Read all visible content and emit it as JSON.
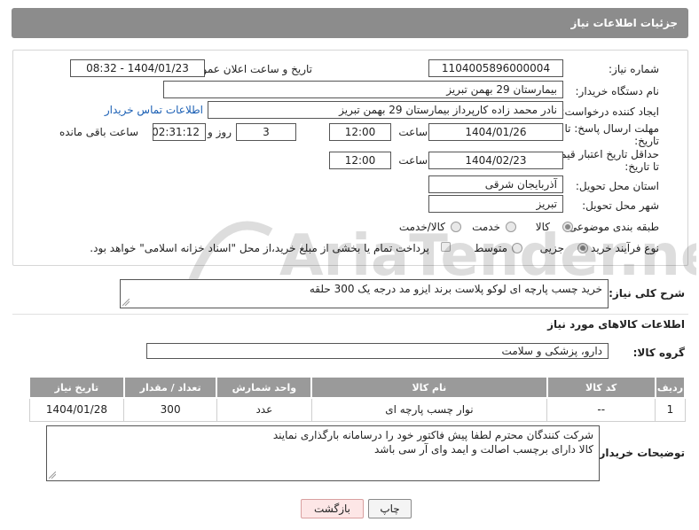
{
  "header": {
    "title": "جزئیات اطلاعات نیاز"
  },
  "fields": {
    "need_number_label": "شماره نیاز:",
    "need_number": "1104005896000004",
    "announce_label": "تاریخ و ساعت اعلان عمومی:",
    "announce_value": "1404/01/23 - 08:32",
    "buyer_org_label": "نام دستگاه خریدار:",
    "buyer_org": "بیمارستان 29 بهمن تبریز",
    "creator_label": "ایجاد کننده درخواست:",
    "creator": "نادر محمد زاده کارپرداز بیمارستان 29 بهمن تبریز",
    "buyer_contact_link": "اطلاعات تماس خریدار",
    "reply_deadline_label_1": "مهلت ارسال پاسخ: تا",
    "reply_deadline_label_2": "تاریخ:",
    "reply_date": "1404/01/26",
    "time_label": "ساعت",
    "reply_time": "12:00",
    "days_value": "3",
    "days_label": "روز و",
    "remaining_time": "02:31:12",
    "remaining_label": "ساعت باقی مانده",
    "price_validity_label_1": "حداقل تاریخ اعتبار قیمت:",
    "price_validity_label_2": "تا تاریخ:",
    "validity_date": "1404/02/23",
    "validity_time": "12:00",
    "province_label": "استان محل تحویل:",
    "province": "آذربایجان شرقی",
    "city_label": "شهر محل تحویل:",
    "city": "تبریز",
    "category_label": "طبقه بندی موضوعی:",
    "category_options": [
      "کالا",
      "خدمت",
      "کالا/خدمت"
    ],
    "process_label": "نوع فرآیند خرید :",
    "process_options": [
      "جزیی",
      "متوسط"
    ],
    "payment_note": "پرداخت تمام یا بخشی از مبلغ خرید،از محل \"اسناد خزانه اسلامی\" خواهد بود."
  },
  "description": {
    "label": "شرح کلی نیاز:",
    "text": "خرید چسب پارچه ای لوکو پلاست برند ایزو مد درجه یک 300 حلقه"
  },
  "goods": {
    "section_title": "اطلاعات کالاهای مورد نیاز",
    "group_label": "گروه کالا:",
    "group_value": "دارو، پزشکی و سلامت",
    "columns": [
      "ردیف",
      "کد کالا",
      "نام کالا",
      "واحد شمارش",
      "تعداد / مقدار",
      "تاریخ نیاز"
    ],
    "rows": [
      {
        "row": "1",
        "code": "--",
        "name": "نوار چسب پارچه ای",
        "unit": "عدد",
        "qty": "300",
        "date": "1404/01/28"
      }
    ]
  },
  "buyer_notes": {
    "label": "توضیحات خریدار:",
    "line1": "شرکت کنندگان محترم لطفا پیش فاکتور خود را درسامانه بارگذاری نمایند",
    "line2": "کالا دارای برچسب اصالت و ایمد وای آر سی باشد"
  },
  "buttons": {
    "print": "چاپ",
    "back": "بازگشت"
  },
  "watermark_text": "AriaTender.neT"
}
